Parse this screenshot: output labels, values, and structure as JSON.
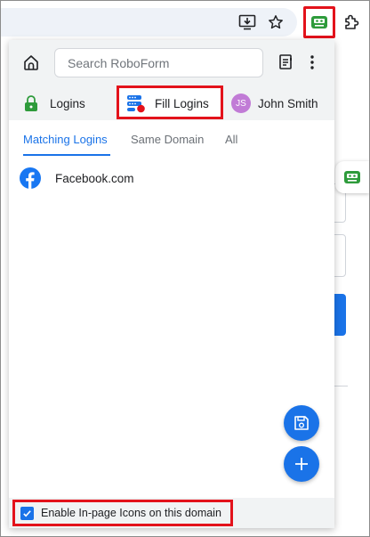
{
  "search": {
    "placeholder": "Search RoboForm"
  },
  "nav": {
    "logins": "Logins",
    "fill_logins": "Fill Logins",
    "user": {
      "initials": "JS",
      "name": "John Smith"
    }
  },
  "tabs": [
    {
      "label": "Matching Logins",
      "active": true
    },
    {
      "label": "Same Domain",
      "active": false
    },
    {
      "label": "All",
      "active": false
    }
  ],
  "logins": [
    {
      "site": "Facebook.com",
      "icon": "facebook-icon"
    }
  ],
  "footer": {
    "checkbox_label": "Enable In-page Icons on this domain",
    "checked": true
  },
  "colors": {
    "accent": "#1a73e8",
    "highlight": "#e3121b",
    "roboform_green": "#2e9b3b",
    "avatar": "#c17bd6",
    "facebook": "#1877f2"
  }
}
